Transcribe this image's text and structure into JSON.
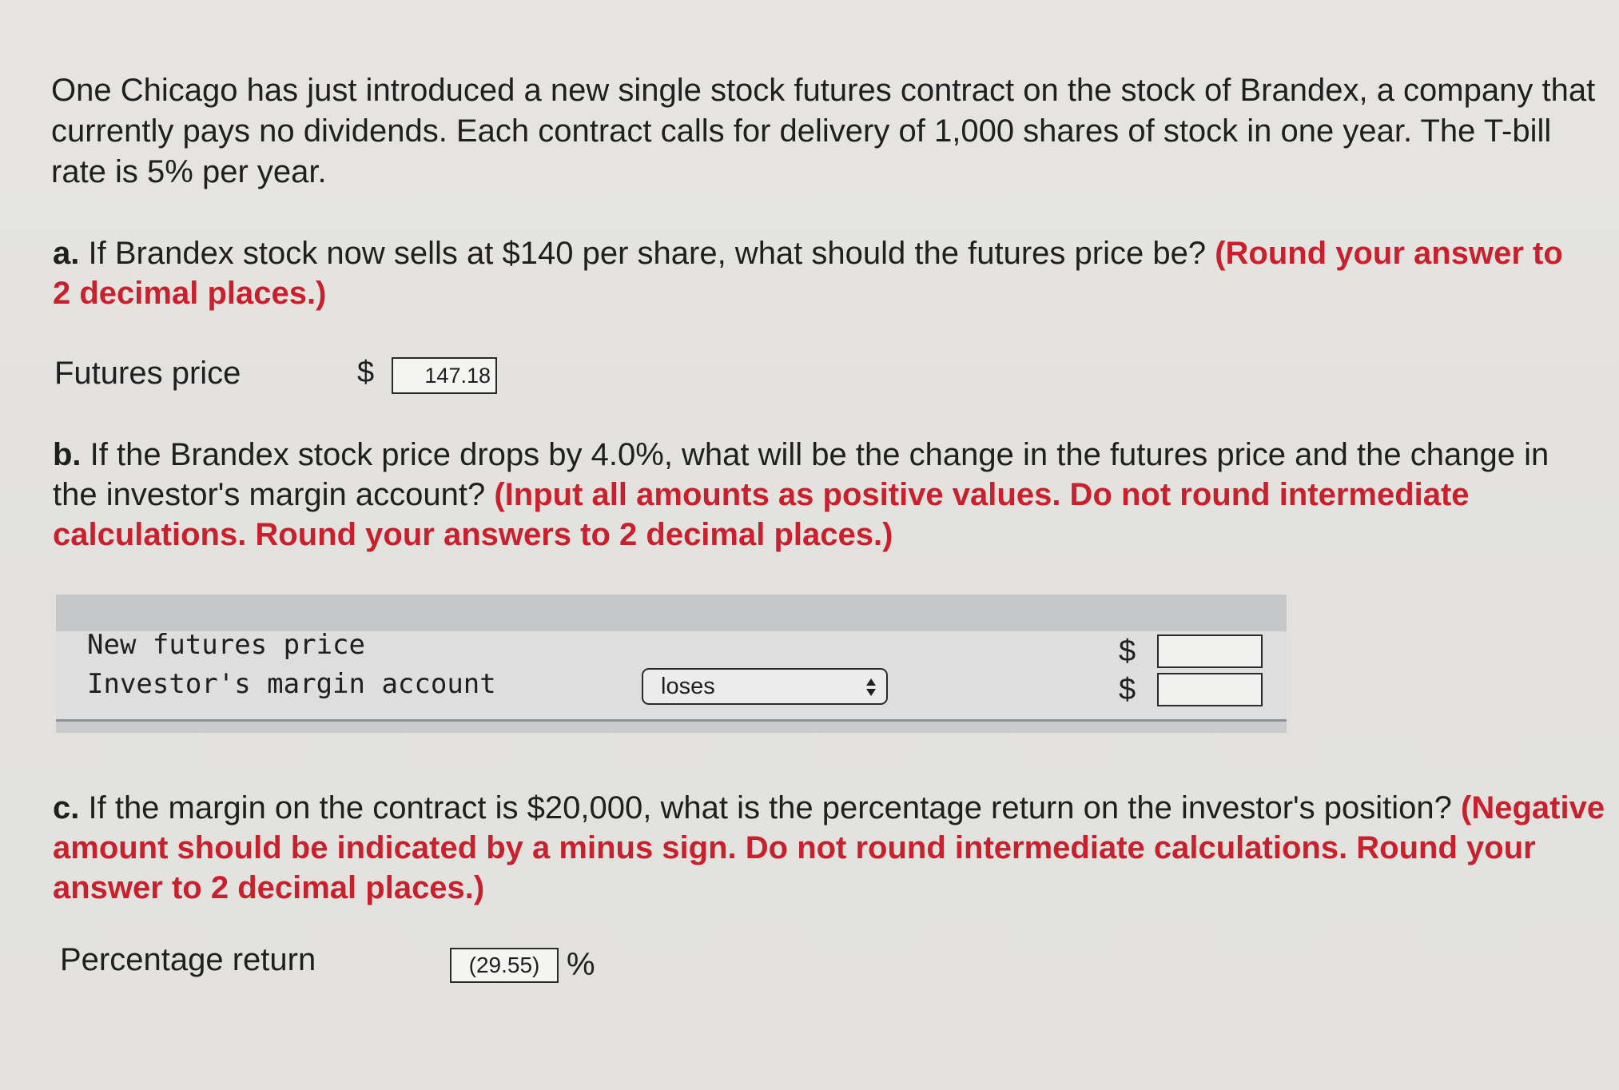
{
  "intro": "One Chicago has just introduced a new single stock futures contract on the stock of Brandex, a company that currently pays no dividends. Each contract calls for delivery of 1,000 shares of stock in one year. The T-bill rate is 5% per year.",
  "part_a": {
    "letter": "a.",
    "question": "If Brandex stock now sells at $140 per share, what should the futures price be?",
    "note": "(Round your answer to 2 decimal places.)",
    "label": "Futures price",
    "currency": "$",
    "value": "147.18"
  },
  "part_b": {
    "letter": "b.",
    "question": "If the Brandex stock price drops by 4.0%, what will be the change in the futures price and the change in the investor's margin account?",
    "note": "(Input all amounts as positive values. Do not round intermediate calculations. Round your answers to 2 decimal places.)",
    "rows": [
      {
        "label": "New futures price",
        "currency": "$",
        "value": ""
      },
      {
        "label": "Investor's margin account",
        "currency": "$",
        "value": "",
        "select": "loses"
      }
    ]
  },
  "part_c": {
    "letter": "c.",
    "question": "If the margin on the contract is $20,000, what is the percentage return on the investor's position?",
    "note": "(Negative amount should be indicated by a minus sign. Do not round intermediate calculations. Round your answer to 2 decimal places.)",
    "label": "Percentage return",
    "value": "(29.55)",
    "unit": "%"
  },
  "colors": {
    "background": "#e4e3e0",
    "text": "#1f1f1f",
    "note_red": "#c8202c",
    "table_header": "#c6c7c9"
  }
}
